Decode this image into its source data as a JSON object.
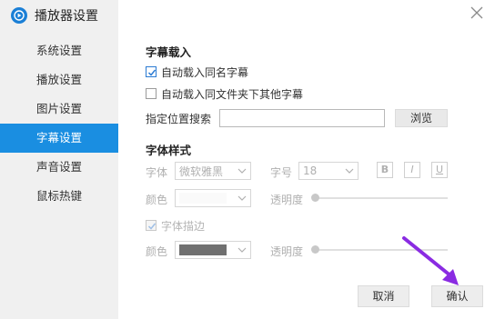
{
  "app": {
    "title": "播放器设置"
  },
  "sidebar": {
    "items": [
      {
        "label": "系统设置",
        "active": false
      },
      {
        "label": "播放设置",
        "active": false
      },
      {
        "label": "图片设置",
        "active": false
      },
      {
        "label": "字幕设置",
        "active": true
      },
      {
        "label": "声音设置",
        "active": false
      },
      {
        "label": "鼠标热键",
        "active": false
      }
    ]
  },
  "subtitle_load": {
    "title": "字幕载入",
    "auto_same_name": {
      "label": "自动载入同名字幕",
      "checked": true
    },
    "auto_folder_other": {
      "label": "自动载入同文件夹下其他字幕",
      "checked": false
    },
    "search_path_label": "指定位置搜索",
    "search_path_value": "",
    "browse_label": "浏览"
  },
  "font_style": {
    "title": "字体样式",
    "font_label": "字体",
    "font_value": "微软雅黑",
    "size_label": "字号",
    "size_value": "18",
    "bold_label": "B",
    "italic_label": "I",
    "underline_label": "U",
    "color_label": "颜色",
    "opacity_label": "透明度",
    "outline": {
      "label": "字体描边",
      "checked": true
    },
    "outline_color_label": "颜色",
    "outline_opacity_label": "透明度"
  },
  "footer": {
    "cancel_label": "取消",
    "ok_label": "确认"
  },
  "colors": {
    "accent": "#1a8ee1",
    "annotation_arrow": "#8a2be2"
  }
}
